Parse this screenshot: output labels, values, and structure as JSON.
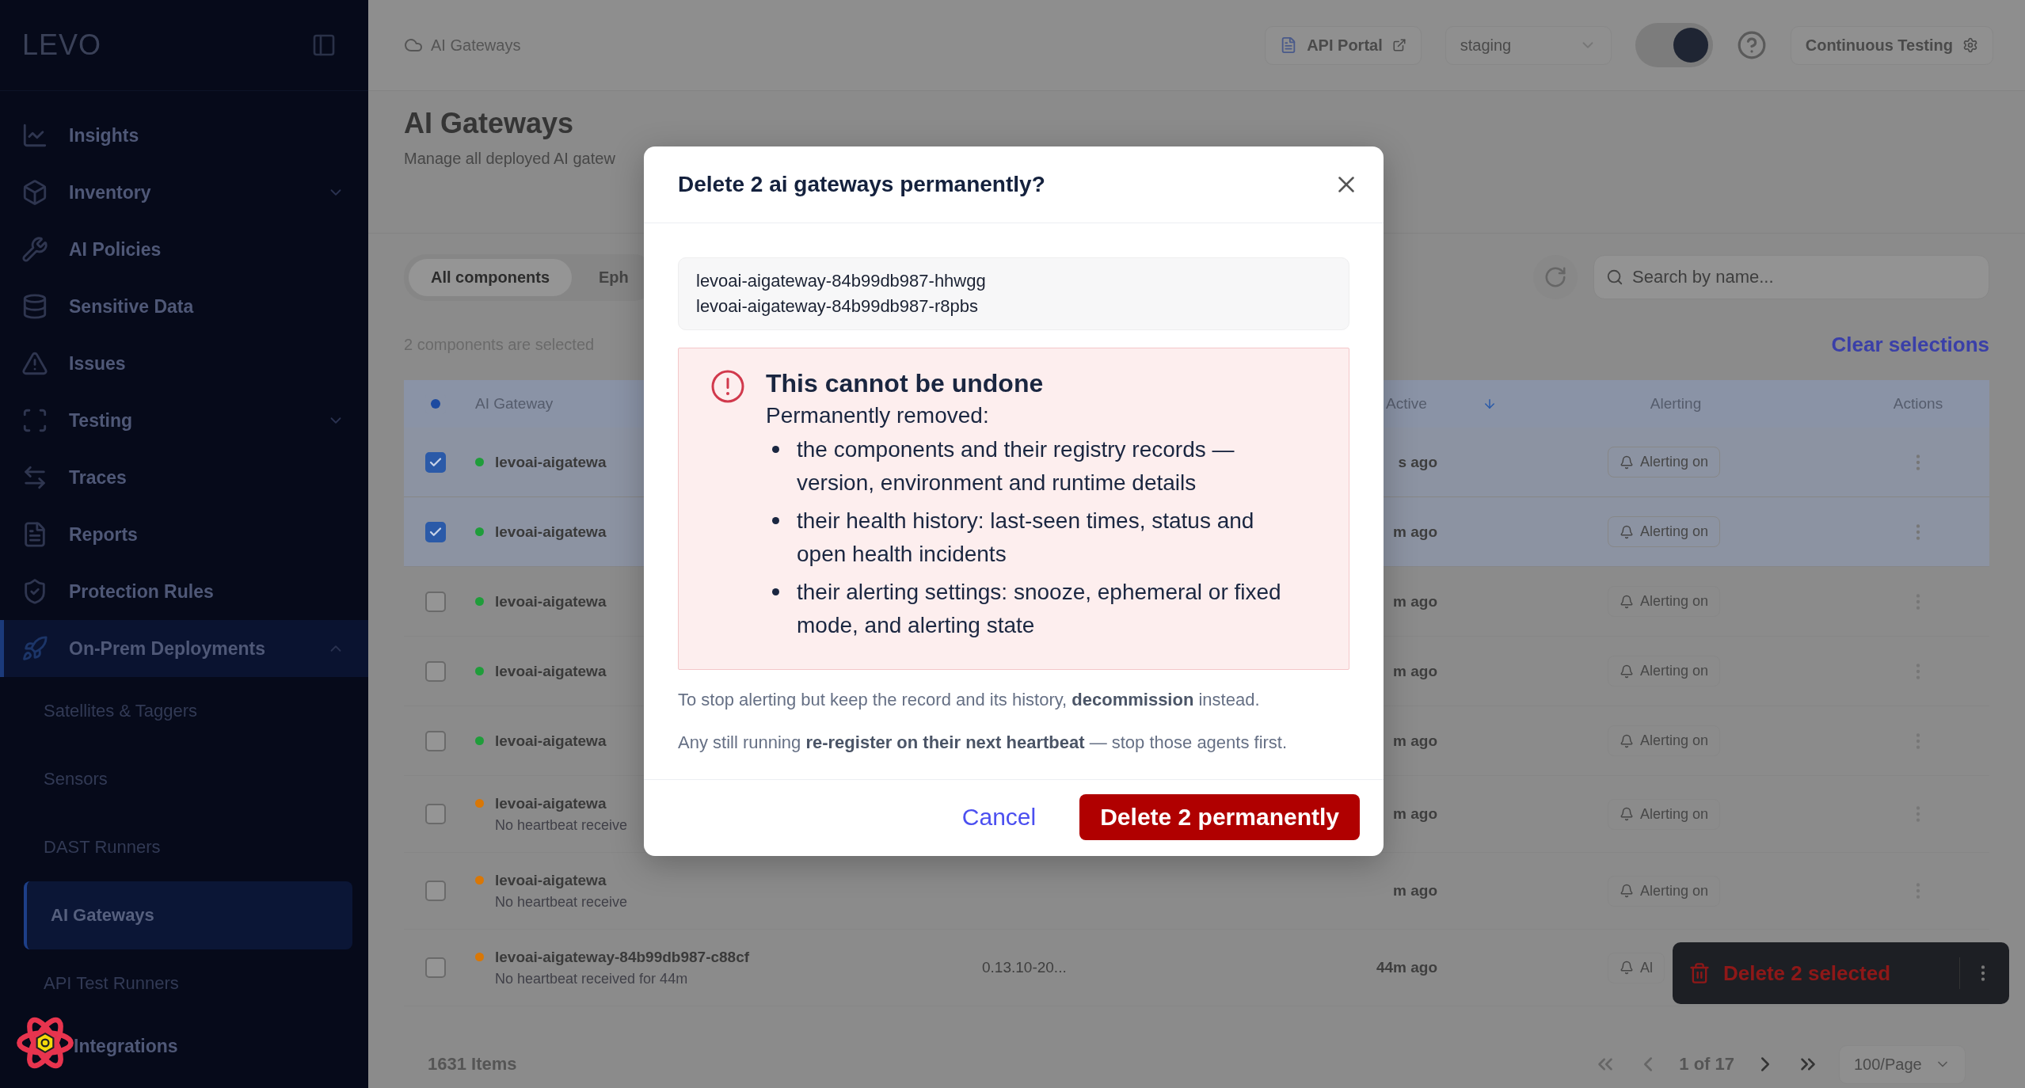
{
  "sidebar": {
    "logo": "LEVO",
    "items": [
      {
        "label": "Insights",
        "kind": "link",
        "selected": false
      },
      {
        "label": "Inventory",
        "kind": "group",
        "selected": false,
        "expanded": false
      },
      {
        "label": "AI Policies",
        "kind": "link",
        "selected": false
      },
      {
        "label": "Sensitive Data",
        "kind": "link",
        "selected": false
      },
      {
        "label": "Issues",
        "kind": "link",
        "selected": false
      },
      {
        "label": "Testing",
        "kind": "group",
        "selected": false,
        "expanded": false
      },
      {
        "label": "Traces",
        "kind": "link",
        "selected": false
      },
      {
        "label": "Reports",
        "kind": "link",
        "selected": false
      },
      {
        "label": "Protection Rules",
        "kind": "link",
        "selected": false
      },
      {
        "label": "On-Prem Deployments",
        "kind": "group",
        "selected": true,
        "expanded": true,
        "children": [
          {
            "label": "Satellites & Taggers",
            "selected": false
          },
          {
            "label": "Sensors",
            "selected": false
          },
          {
            "label": "DAST Runners",
            "selected": false
          },
          {
            "label": "AI Gateways",
            "selected": true
          },
          {
            "label": "API Test Runners",
            "selected": false
          }
        ]
      },
      {
        "label": "Integrations",
        "kind": "link",
        "selected": false
      }
    ]
  },
  "topbar": {
    "breadcrumb": "AI Gateways",
    "api_portal": "API Portal",
    "environment": "staging",
    "theme_toggle": {
      "on": true
    },
    "continuous_testing": "Continuous Testing"
  },
  "page": {
    "title": "AI Gateways",
    "subtitle": "Manage all deployed AI gatew"
  },
  "tabs": [
    {
      "label": "All components",
      "selected": true
    },
    {
      "label": "Eph",
      "selected": false
    }
  ],
  "selection_note": "2 components are selected",
  "search": {
    "placeholder": "Search by name..."
  },
  "clear_selections": "Clear selections",
  "table": {
    "header_checkbox": {
      "indeterminate": true
    },
    "columns": [
      "AI Gateway",
      "Active",
      "Alerting",
      "Actions"
    ],
    "rows": [
      {
        "selected": true,
        "color": "#1f9d3a",
        "name": "levoai-aigatewa",
        "time": "s ago",
        "alerting": "Alerting on"
      },
      {
        "selected": true,
        "color": "#1f9d3a",
        "name": "levoai-aigatewa",
        "time": "m ago",
        "alerting": "Alerting on"
      },
      {
        "selected": false,
        "color": "#1f9d3a",
        "name": "levoai-aigatewa",
        "time": "m ago",
        "alerting": "Alerting on"
      },
      {
        "selected": false,
        "color": "#1f9d3a",
        "name": "levoai-aigatewa",
        "time": "m ago",
        "alerting": "Alerting on"
      },
      {
        "selected": false,
        "color": "#1f9d3a",
        "name": "levoai-aigatewa",
        "time": "m ago",
        "alerting": "Alerting on"
      },
      {
        "selected": false,
        "color": "#d97706",
        "name": "levoai-aigatewa",
        "note": "No heartbeat receive",
        "time": "m ago",
        "alerting": "Alerting on"
      },
      {
        "selected": false,
        "color": "#d97706",
        "name": "levoai-aigatewa",
        "note": "No heartbeat receive",
        "time": "m ago",
        "alerting": "Alerting on"
      },
      {
        "selected": false,
        "color": "#d97706",
        "name": "levoai-aigateway-84b99db987-c88cf",
        "note": "No heartbeat received for 44m",
        "version": "0.13.10-20...",
        "time": "44m ago",
        "alerting": "Al"
      }
    ]
  },
  "pagination": {
    "total": "1631 Items",
    "page": "1 of 17",
    "page_size": "100/Page"
  },
  "selection_bar": {
    "label": "Delete 2 selected"
  },
  "dialog": {
    "title": "Delete 2 ai gateways permanently?",
    "names": [
      "levoai-aigateway-84b99db987-hhwgg",
      "levoai-aigateway-84b99db987-r8pbs"
    ],
    "warning": {
      "title": "This cannot be undone",
      "lead": "Permanently removed:",
      "items": [
        "the components and their registry records — version, environment and runtime details",
        "their health history: last-seen times, status and open health incidents",
        "their alerting settings: snooze, ephemeral or fixed mode, and alerting state"
      ]
    },
    "notes": [
      "To stop alerting but keep the record and its history, **decommission** instead.",
      "Any still running **re-register on their next heartbeat** — stop those agents first."
    ],
    "cancel": "Cancel",
    "confirm": "Delete 2 permanently"
  }
}
